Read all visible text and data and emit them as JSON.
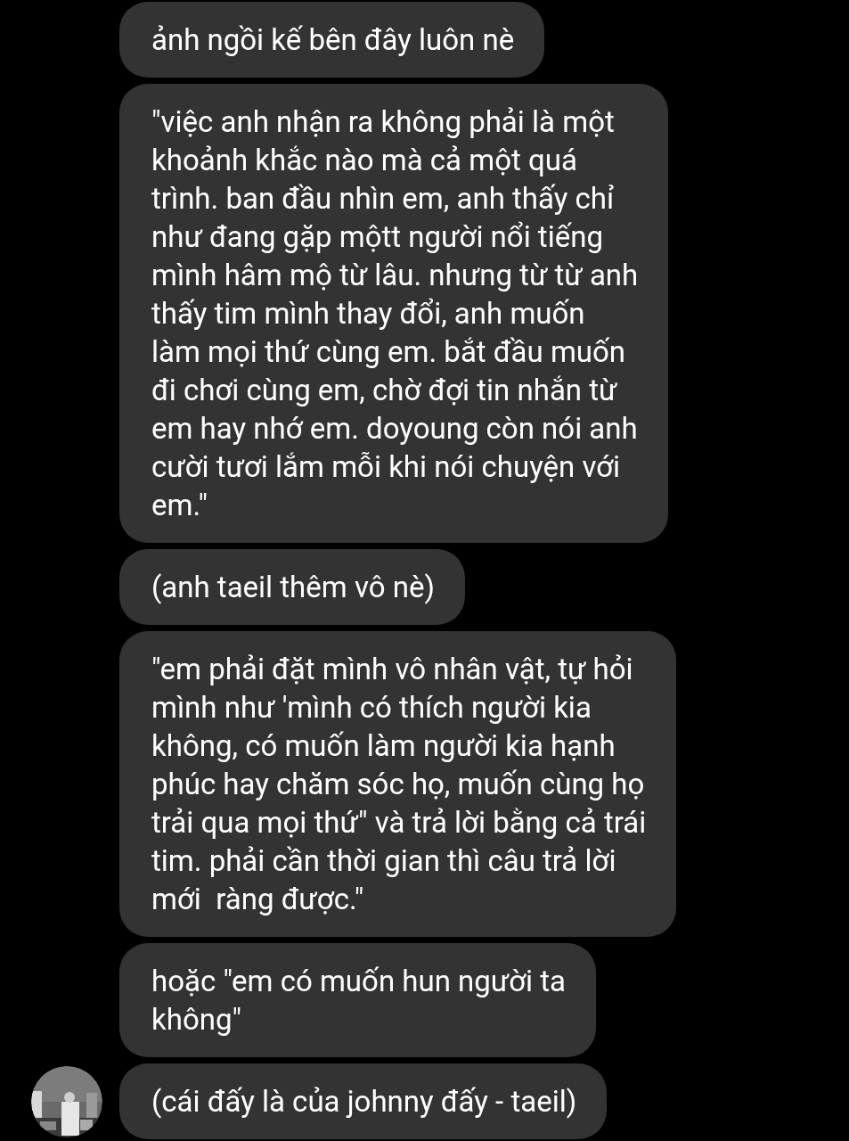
{
  "messages": [
    {
      "text": "ảnh ngồi kế bên đây luôn nè"
    },
    {
      "text": "\"việc anh nhận ra không phải là một\nkhoảnh khắc nào mà cả một quá\ntrình. ban đầu nhìn em, anh thấy chỉ\nnhư đang gặp mộtt người nổi tiếng\nmình hâm mộ từ lâu. nhưng từ từ anh\nthấy tim mình thay đổi, anh muốn\nlàm mọi thứ cùng em. bắt đầu muốn\nđi chơi cùng em, chờ đợi tin nhắn từ\nem hay nhớ em. doyoung còn nói anh\ncười tươi lắm mỗi khi nói chuyện với\nem.\""
    },
    {
      "text": "(anh taeil thêm vô nè)"
    },
    {
      "text": "\"em phải đặt mình vô nhân vật, tự hỏi\nmình như 'mình có thích người kia\nkhông, có muốn làm người kia hạnh\nphúc hay chăm sóc họ, muốn cùng họ\ntrải qua mọi thứ\" và trả lời bằng cả trái\ntim. phải cần thời gian thì câu trả lời\nmới  ràng được.\""
    },
    {
      "text": "hoặc \"em có muốn hun người ta\nkhông\""
    },
    {
      "text": "(cái đấy là của johnny đấy - taeil)"
    }
  ]
}
